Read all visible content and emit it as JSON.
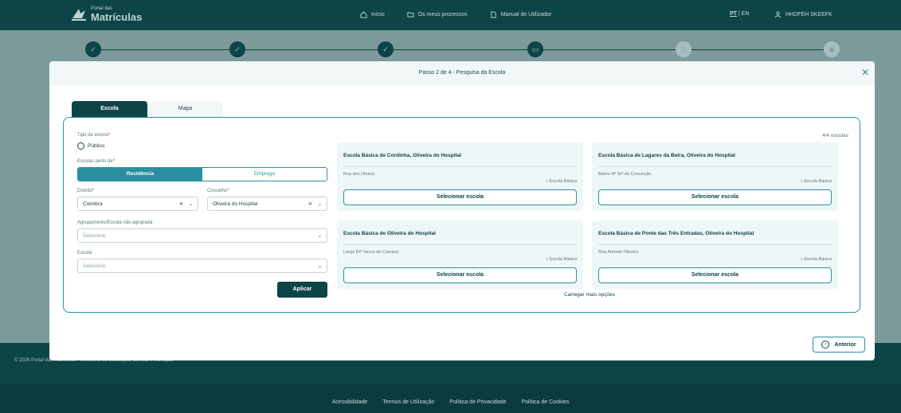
{
  "header": {
    "logo_small": "Portal das",
    "logo_big": "Matrículas",
    "nav": [
      {
        "label": "Início",
        "icon": "home-icon"
      },
      {
        "label": "Os meus processos",
        "icon": "folder-icon"
      },
      {
        "label": "Manual de Utilizador",
        "icon": "document-icon"
      }
    ],
    "lang_pt": "PT",
    "lang_sep": "|",
    "lang_en": "EN",
    "user_name": "HHDFEH SKEEFK"
  },
  "stepper": {
    "steps": [
      "done",
      "done",
      "done",
      "current",
      "todo",
      "todo"
    ]
  },
  "footer": {
    "copyright": "© 2026 Portal das Matrículas - Ministério da Educação, Ciência e Inovação",
    "links": [
      "Acessibilidade",
      "Termos de Utilização",
      "Política de Privacidade",
      "Política de Cookies"
    ]
  },
  "modal": {
    "title": "Passo 2 de 4 - Pesquisa da Escola",
    "tabs": [
      "Escola",
      "Mapa"
    ],
    "form": {
      "tipo_label": "Tipo de ensino",
      "tipo_option": "Público",
      "perto_label": "Escolas perto de",
      "perto_options": [
        "Residência",
        "Emprego"
      ],
      "distrito_label": "Distrito",
      "distrito_value": "Coimbra",
      "concelho_label": "Concelho",
      "concelho_value": "Oliveira do Hospital",
      "agrupamento_label": "Agrupamento/Escola não agrupada",
      "agrupamento_placeholder": "Selecione",
      "escola_label": "Escola",
      "escola_placeholder": "Selecione",
      "apply_label": "Aplicar"
    },
    "results_count": "4/4 escolas",
    "schools": [
      {
        "name": "Escola Básica de Cordinha, Oliveira do Hospital",
        "address": "Rua dos Oleiros",
        "type": "Escola Básica",
        "button": "Selecionar escola"
      },
      {
        "name": "Escola Básica de Lagares da Beira, Oliveira do Hospital",
        "address": "Bairro Nª Srª da Conceição",
        "type": "Escola Básica",
        "button": "Selecionar escola"
      },
      {
        "name": "Escola Básica de Oliveira do Hospital",
        "address": "Largo Drº Vasco de Campos",
        "type": "Escola Básica",
        "button": "Selecionar escola"
      },
      {
        "name": "Escola Básica de Ponte das Três Entradas, Oliveira do Hospital",
        "address": "Rua António Oliveira",
        "type": "Escola Básica",
        "button": "Selecionar escola"
      }
    ],
    "load_more": "Carregar mais opções",
    "back_label": "Anterior"
  },
  "colors": {
    "primary_dark": "#0d4447",
    "accent": "#2a8fa0",
    "card_bg": "#eff6f7"
  }
}
